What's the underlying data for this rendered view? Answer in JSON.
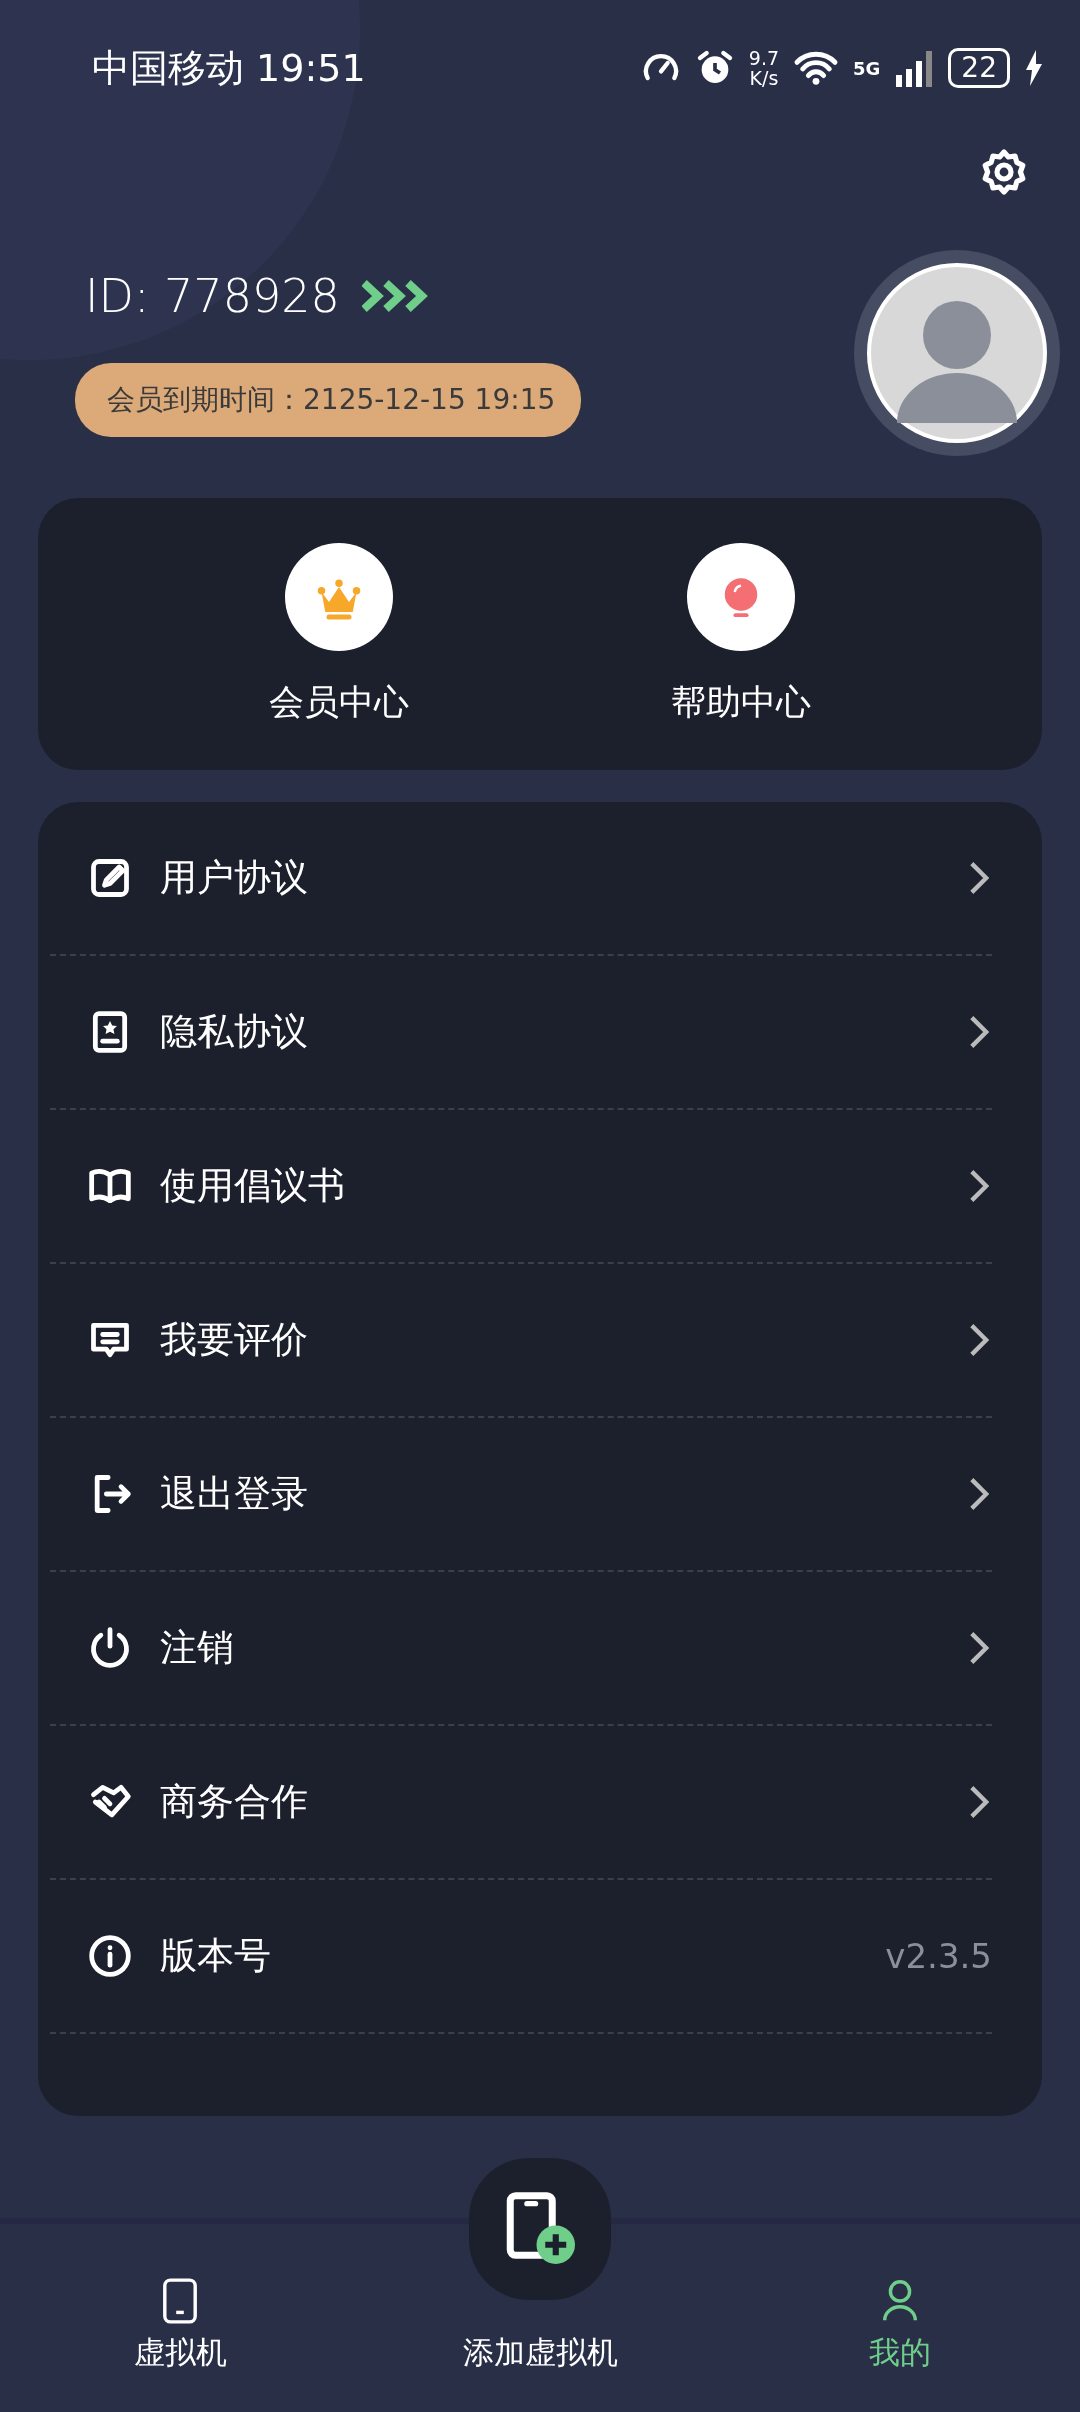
{
  "status_bar": {
    "carrier_time": "中国移动 19:51",
    "net_speed": "9.7",
    "net_speed_unit": "K/s",
    "network": "5G",
    "battery": "22"
  },
  "profile": {
    "id": "ID: 778928",
    "membership_expiry": "会员到期时间：2125-12-15 19:15"
  },
  "shortcuts": [
    {
      "label": "会员中心",
      "kind": "crown"
    },
    {
      "label": "帮助中心",
      "kind": "bulb"
    }
  ],
  "menu": [
    {
      "label": "用户协议",
      "kind": "edit"
    },
    {
      "label": "隐私协议",
      "kind": "badge"
    },
    {
      "label": "使用倡议书",
      "kind": "book"
    },
    {
      "label": "我要评价",
      "kind": "comment"
    },
    {
      "label": "退出登录",
      "kind": "logout"
    },
    {
      "label": "注销",
      "kind": "power"
    },
    {
      "label": "商务合作",
      "kind": "handshake"
    },
    {
      "label": "版本号",
      "kind": "info",
      "value": "v2.3.5"
    }
  ],
  "bottom_nav": [
    {
      "label": "虚拟机",
      "kind": "phone",
      "selected": false
    },
    {
      "label": "添加虚拟机",
      "kind": "add",
      "selected": false
    },
    {
      "label": "我的",
      "kind": "person",
      "selected": true
    }
  ]
}
